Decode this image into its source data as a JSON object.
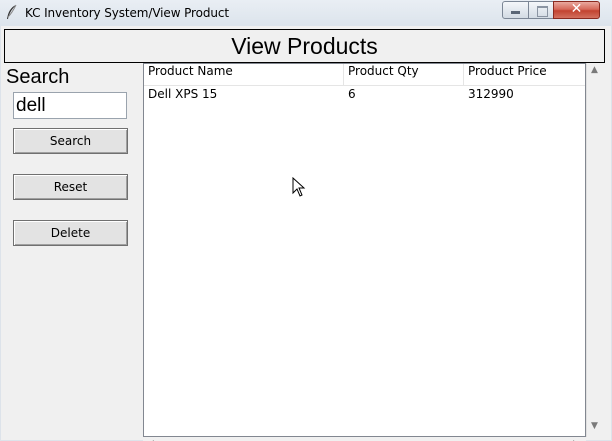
{
  "window": {
    "title": "KC Inventory System/View Product",
    "close_glyph": "✕"
  },
  "header": {
    "title": "View Products"
  },
  "sidebar": {
    "search_label": "Search",
    "search_value": "dell",
    "buttons": {
      "search": "Search",
      "reset": "Reset",
      "delete": "Delete"
    }
  },
  "table": {
    "columns": [
      "Product Name",
      "Product Qty",
      "Product Price"
    ],
    "rows": [
      [
        "Dell XPS 15",
        "6",
        "312990"
      ]
    ]
  },
  "scrollbars": {
    "up": "▲",
    "down": "▼",
    "left": "◀",
    "right": "▶"
  }
}
